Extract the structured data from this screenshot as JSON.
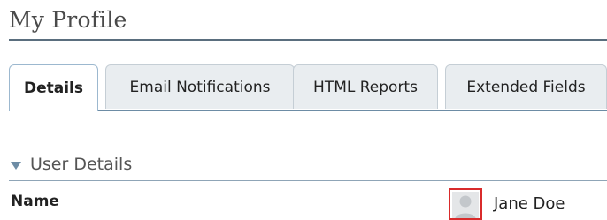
{
  "page": {
    "title": "My Profile"
  },
  "tabs": [
    {
      "label": "Details",
      "active": true
    },
    {
      "label": "Email Notifications",
      "active": false
    },
    {
      "label": "HTML Reports",
      "active": false
    },
    {
      "label": "Extended Fields",
      "active": false
    }
  ],
  "section": {
    "label": "User Details",
    "icon": "collapse-triangle-icon"
  },
  "fields": {
    "name_label": "Name",
    "name_value": "Jane Doe",
    "avatar_icon": "user-avatar-placeholder-icon"
  },
  "colors": {
    "accent": "#6d8ca5",
    "avatar_border": "#d92b2b",
    "tab_inactive_bg": "#e9edf0"
  }
}
